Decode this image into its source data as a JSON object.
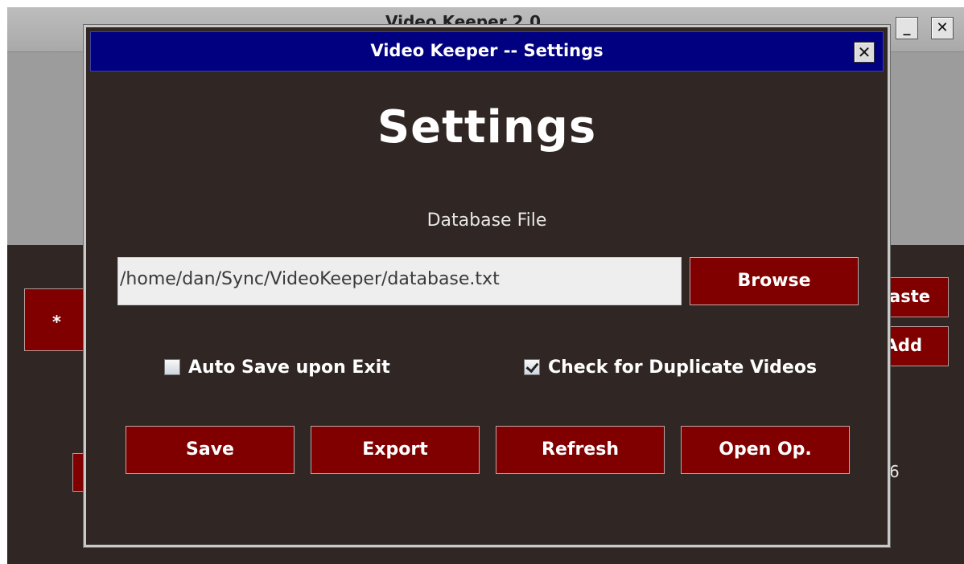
{
  "background_window": {
    "title": "Video Keeper 2.0",
    "minimize_glyph": "_",
    "close_glyph": "✕",
    "left_button_label": "*",
    "right_button_1_label": "Paste",
    "right_button_2_label": "Add",
    "side_text": "6"
  },
  "dialog": {
    "title": "Video Keeper -- Settings",
    "close_glyph": "✕",
    "heading": "Settings",
    "database_label": "Database File",
    "database_path": "/home/dan/Sync/VideoKeeper/database.txt",
    "browse_label": "Browse",
    "auto_save": {
      "label": "Auto Save upon Exit",
      "checked": false
    },
    "check_duplicates": {
      "label": "Check for Duplicate Videos",
      "checked": true
    },
    "actions": [
      {
        "label": "Save"
      },
      {
        "label": "Export"
      },
      {
        "label": "Refresh"
      },
      {
        "label": "Open Op."
      }
    ]
  },
  "colors": {
    "titlebar": "#000080",
    "button": "#800000",
    "panel": "#302623"
  },
  "icons": {
    "dialog_close": "close-icon",
    "checkbox_checked": "checkmark-icon"
  }
}
